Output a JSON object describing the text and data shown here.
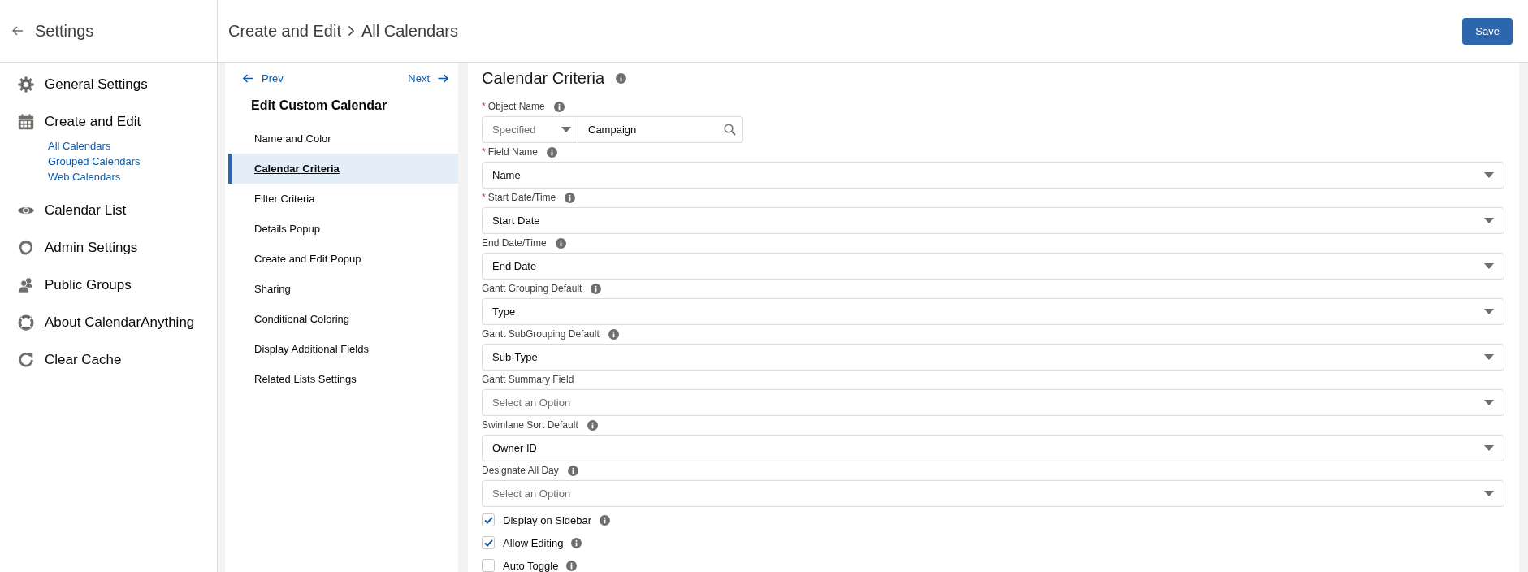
{
  "sidebar": {
    "title": "Settings",
    "items": [
      {
        "kind": "gear",
        "label": "General Settings"
      },
      {
        "kind": "calendar",
        "label": "Create and Edit",
        "children": [
          {
            "label": "All Calendars"
          },
          {
            "label": "Grouped Calendars"
          },
          {
            "label": "Web Calendars"
          }
        ]
      },
      {
        "kind": "eye",
        "label": "Calendar List"
      },
      {
        "kind": "headset",
        "label": "Admin Settings"
      },
      {
        "kind": "people",
        "label": "Public Groups"
      },
      {
        "kind": "lifebuoy",
        "label": "About CalendarAnything"
      },
      {
        "kind": "refresh",
        "label": "Clear Cache"
      }
    ]
  },
  "header": {
    "breadcrumb": [
      "Create and Edit",
      "All Calendars"
    ],
    "save_button": "Save"
  },
  "steps": {
    "prev": "Prev",
    "next": "Next",
    "title": "Edit Custom Calendar",
    "items": [
      {
        "label": "Name and Color",
        "selected": false
      },
      {
        "label": "Calendar Criteria",
        "selected": true
      },
      {
        "label": "Filter Criteria",
        "selected": false
      },
      {
        "label": "Details Popup",
        "selected": false
      },
      {
        "label": "Create and Edit Popup",
        "selected": false
      },
      {
        "label": "Sharing",
        "selected": false
      },
      {
        "label": "Conditional Coloring",
        "selected": false
      },
      {
        "label": "Display Additional Fields",
        "selected": false
      },
      {
        "label": "Related Lists Settings",
        "selected": false
      }
    ]
  },
  "form": {
    "title": "Calendar Criteria",
    "fields": [
      {
        "kind": "lookup",
        "required_mark": "*",
        "label": "Object Name",
        "info": true,
        "scope": "Specified",
        "value": "Campaign"
      },
      {
        "kind": "select",
        "required_mark": "*",
        "label": "Field Name",
        "info": true,
        "value": "Name"
      },
      {
        "kind": "select",
        "required_mark": "*",
        "label": "Start Date/Time",
        "info": true,
        "value": "Start Date"
      },
      {
        "kind": "select",
        "label": "End Date/Time",
        "info": true,
        "value": "End Date"
      },
      {
        "kind": "select",
        "label": "Gantt Grouping Default",
        "info": true,
        "value": "Type"
      },
      {
        "kind": "select",
        "label": "Gantt SubGrouping Default",
        "info": true,
        "value": "Sub-Type"
      },
      {
        "kind": "select",
        "label": "Gantt Summary Field",
        "info": false,
        "placeholder": "Select an Option"
      },
      {
        "kind": "select",
        "label": "Swimlane Sort Default",
        "info": true,
        "value": "Owner ID"
      },
      {
        "kind": "select",
        "label": "Designate All Day",
        "info": true,
        "placeholder": "Select an Option"
      },
      {
        "kind": "checkbox",
        "label": "Display on Sidebar",
        "info": true,
        "checked": true
      },
      {
        "kind": "checkbox",
        "label": "Allow Editing",
        "info": true,
        "checked": true
      },
      {
        "kind": "checkbox",
        "label": "Auto Toggle",
        "info": true,
        "checked": false
      }
    ]
  }
}
